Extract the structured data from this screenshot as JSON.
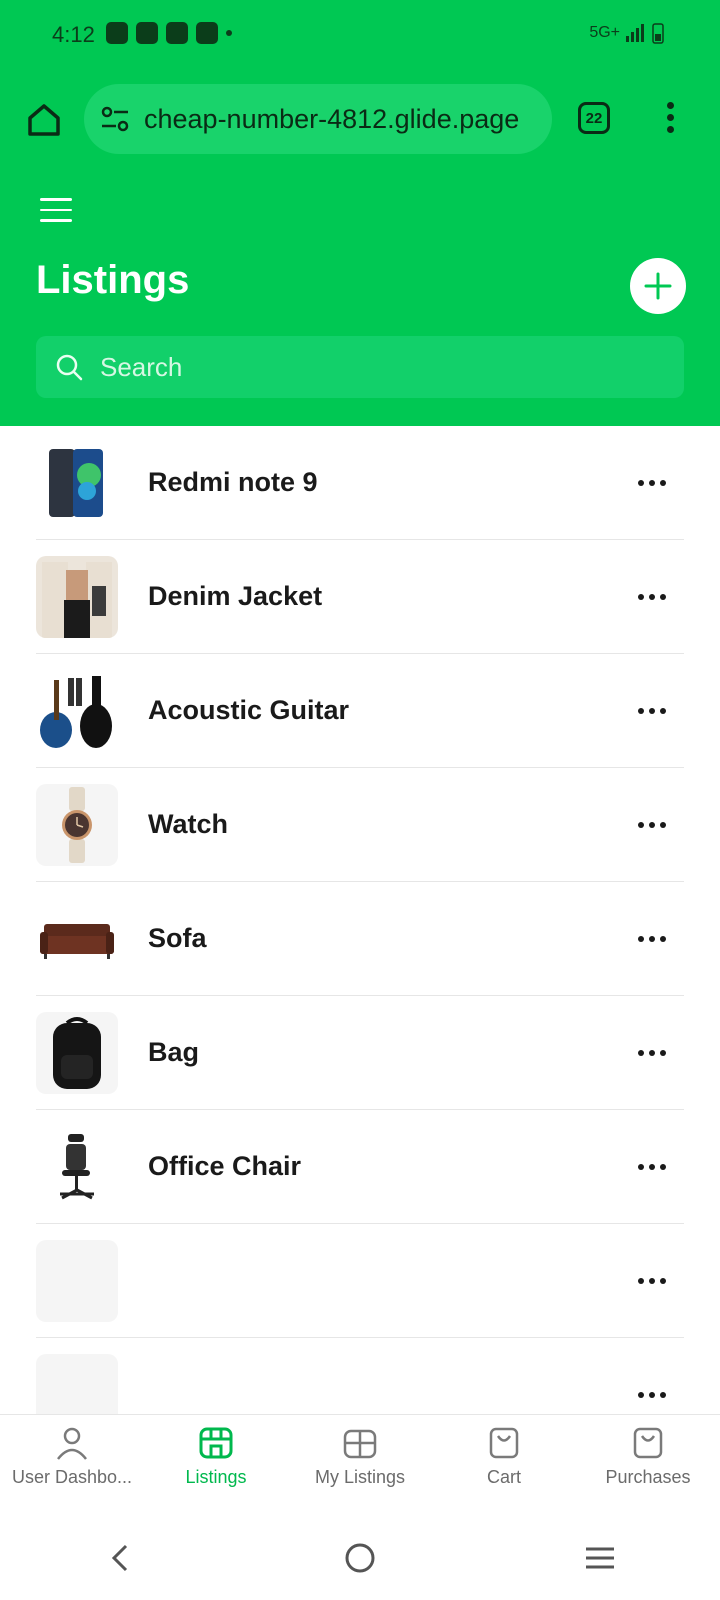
{
  "status_bar": {
    "time": "4:12",
    "network": "5G+"
  },
  "browser": {
    "url": "cheap-number-4812.glide.page",
    "tab_count": "22"
  },
  "header": {
    "title": "Listings",
    "search_placeholder": "Search"
  },
  "listings": [
    {
      "title": "Redmi note 9",
      "image": "phone"
    },
    {
      "title": "Denim Jacket",
      "image": "jacket"
    },
    {
      "title": "Acoustic Guitar",
      "image": "guitar"
    },
    {
      "title": "Watch",
      "image": "watch"
    },
    {
      "title": "Sofa",
      "image": "sofa"
    },
    {
      "title": "Bag",
      "image": "bag"
    },
    {
      "title": "Office Chair",
      "image": "chair"
    },
    {
      "title": "",
      "image": "placeholder"
    },
    {
      "title": "",
      "image": "placeholder"
    }
  ],
  "bottom_nav": {
    "items": [
      {
        "label": "User Dashbo...",
        "icon": "user-icon"
      },
      {
        "label": "Listings",
        "icon": "store-icon",
        "active": true
      },
      {
        "label": "My Listings",
        "icon": "grid-icon"
      },
      {
        "label": "Cart",
        "icon": "bag-icon"
      },
      {
        "label": "Purchases",
        "icon": "bag-icon"
      }
    ]
  },
  "colors": {
    "brand": "#00c853",
    "active_nav": "#00b84d"
  }
}
